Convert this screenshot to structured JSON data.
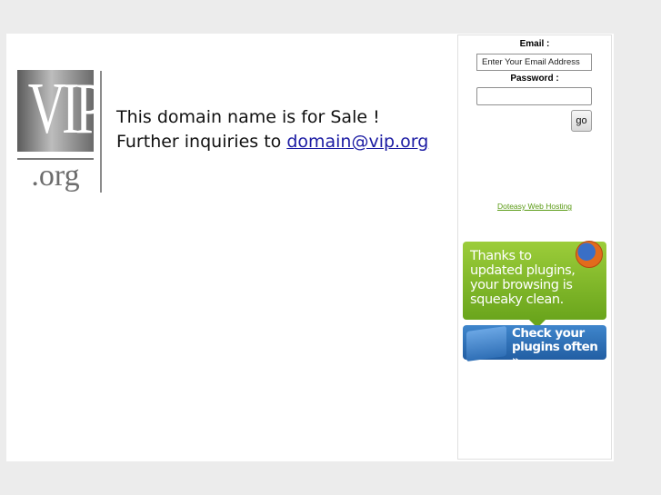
{
  "logo": {
    "main_text": "VIP",
    "suffix_text": ".org"
  },
  "sale": {
    "line1": "This domain name is for Sale !",
    "line2_prefix": "Further inquiries to ",
    "email_link": "domain@vip.org"
  },
  "login": {
    "email_label": "Email :",
    "email_value": "Enter Your Email Address",
    "password_label": "Password :",
    "go_label": "go"
  },
  "hosting_link": "Doteasy Web Hosting",
  "firefox_banner": {
    "message": "Thanks to updated plugins, your browsing is squeaky clean.",
    "cta": "Check your plugins often »",
    "icon": "firefox-icon"
  },
  "colors": {
    "background": "#ececec",
    "link": "#1b1ba3",
    "hosting_link": "#5a9a14",
    "banner_green": "#8cc22e",
    "banner_blue": "#2f72b8"
  }
}
